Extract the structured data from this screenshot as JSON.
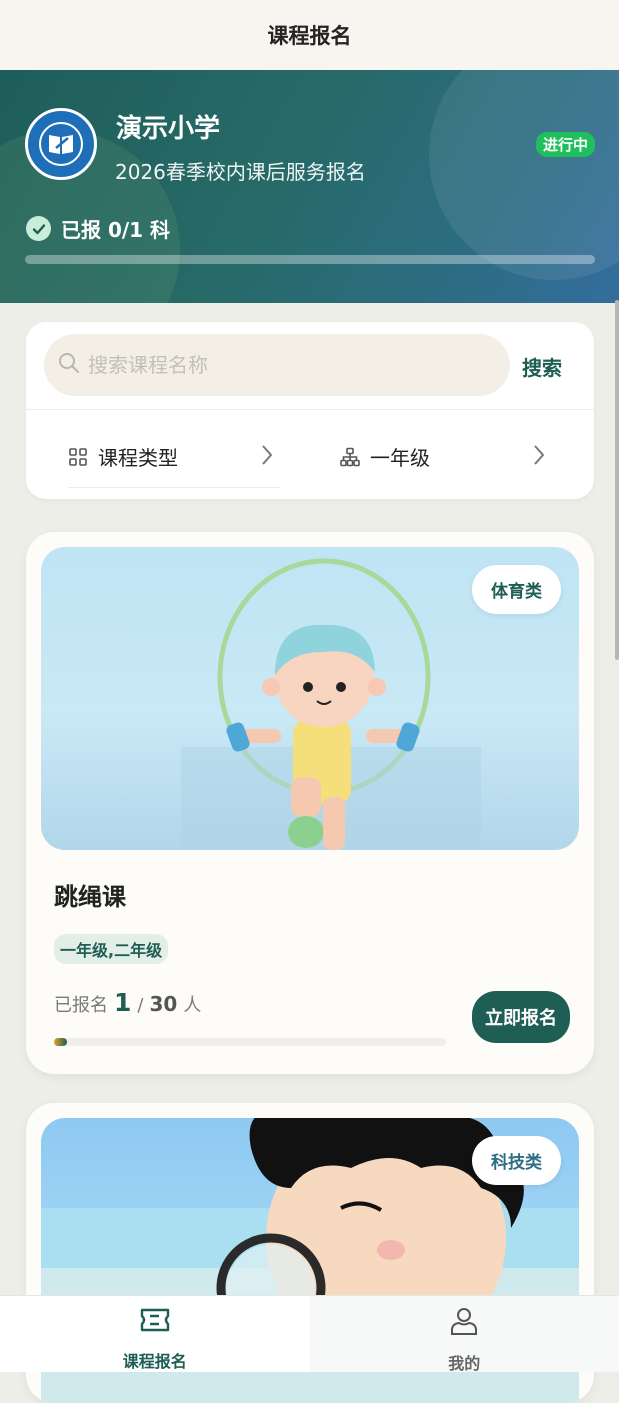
{
  "header": {
    "title": "课程报名"
  },
  "hero": {
    "school_name": "演示小学",
    "subtitle": "2026春季校内课后服务报名",
    "status": "进行中",
    "enrolled_text": "已报 0/1 科",
    "enrolled_progress": 0
  },
  "search": {
    "placeholder": "搜索课程名称",
    "value": "",
    "button_label": "搜索"
  },
  "filters": {
    "type_label": "课程类型",
    "grade_label": "一年级"
  },
  "courses": [
    {
      "type": "体育类",
      "title": "跳绳课",
      "grades": "一年级,二年级",
      "enrolled_label": "已报名",
      "enrolled": "1",
      "separator": "/",
      "capacity": "30",
      "unit": "人",
      "button_label": "立即报名",
      "progress": 0.033
    },
    {
      "type": "科技类"
    }
  ],
  "tabbar": [
    {
      "label": "课程报名",
      "icon": "ticket-icon",
      "active": true
    },
    {
      "label": "我的",
      "icon": "user-icon",
      "active": false
    }
  ],
  "colors": {
    "primary": "#1e5e54",
    "status_green": "#1fbf5c",
    "hero_start": "#1e5e5a",
    "hero_end": "#346d9e"
  }
}
